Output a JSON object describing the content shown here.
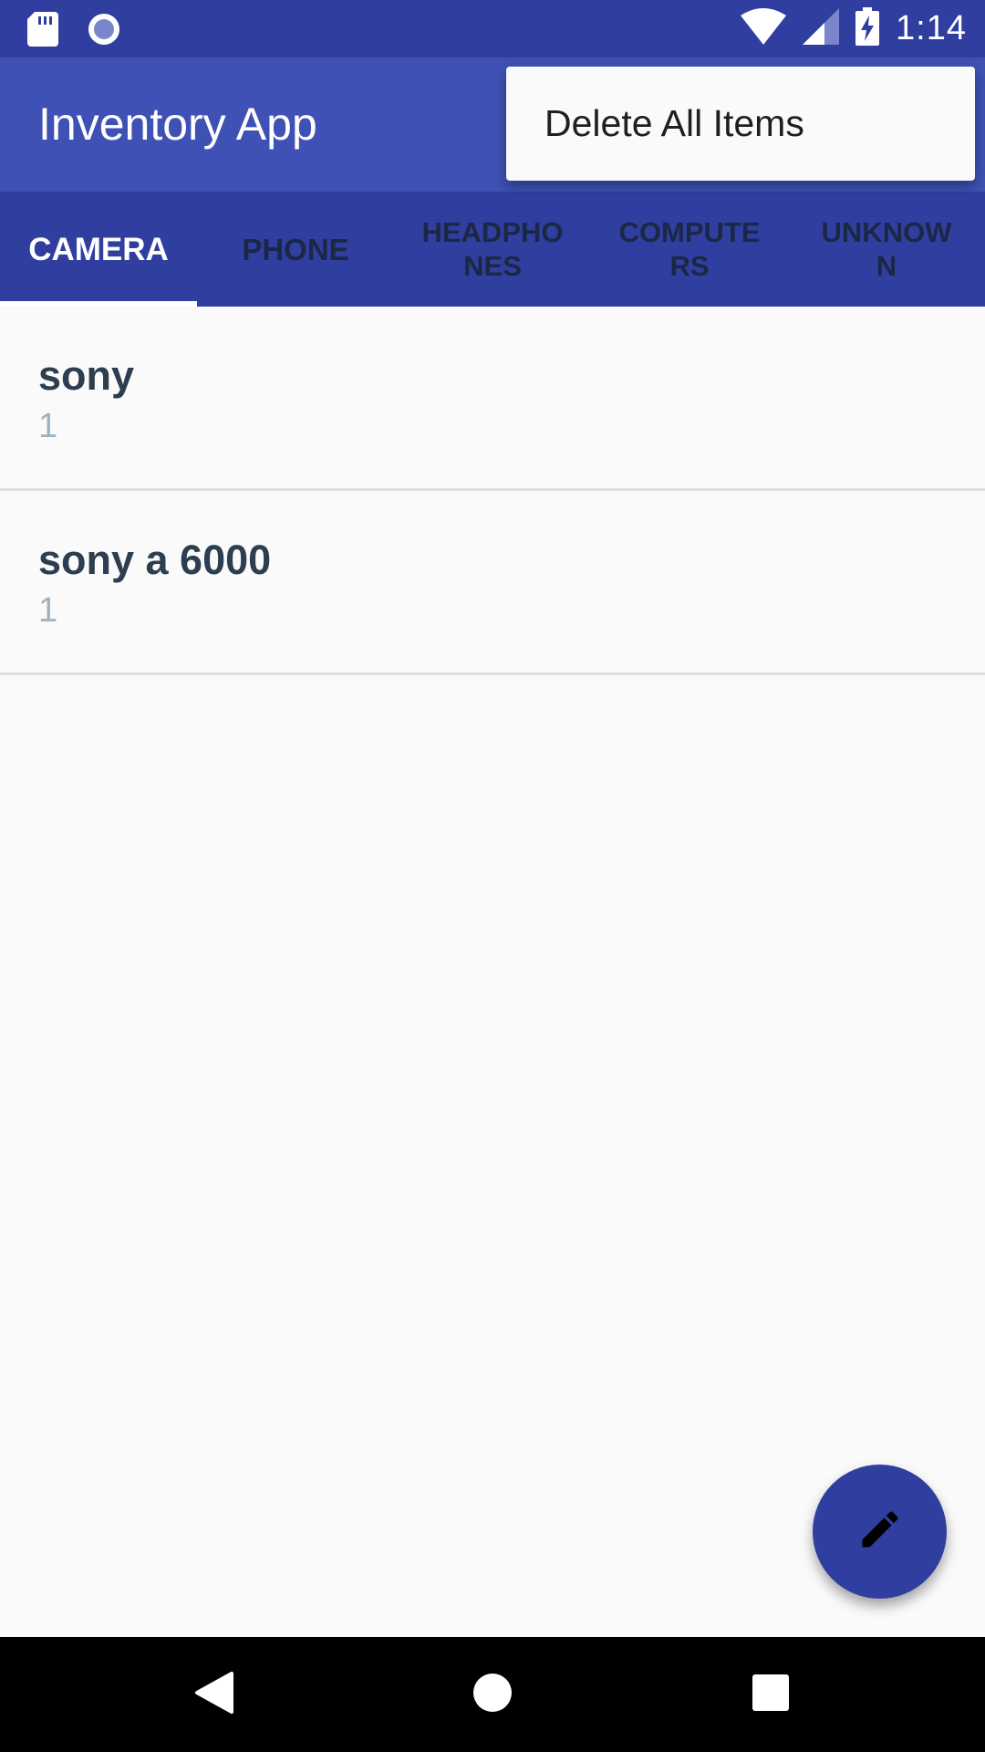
{
  "status_bar": {
    "time": "1:14",
    "icons": [
      "sd-card-icon",
      "record-icon",
      "wifi-icon",
      "signal-icon",
      "battery-charging-icon"
    ]
  },
  "app_bar": {
    "title": "Inventory App"
  },
  "overflow_menu": {
    "items": [
      {
        "label": "Delete All Items"
      }
    ]
  },
  "tabs": [
    {
      "label": "CAMERA",
      "active": true
    },
    {
      "label": "PHONE",
      "active": false
    },
    {
      "label": "HEADPHONES",
      "active": false
    },
    {
      "label": "COMPUTERS",
      "active": false
    },
    {
      "label": "UNKNOWN",
      "active": false
    }
  ],
  "items": [
    {
      "name": "sony",
      "quantity": "1"
    },
    {
      "name": "sony a 6000",
      "quantity": "1"
    }
  ],
  "fab": {
    "icon": "edit-pencil-icon"
  },
  "nav_bar": {
    "icons": [
      "back-icon",
      "home-icon",
      "recents-icon"
    ]
  },
  "colors": {
    "primary": "#3f51b5",
    "primary_dark": "#303f9f",
    "background": "#fafafa",
    "item_name": "#2c3e50",
    "item_quantity": "#9fb2c0"
  }
}
